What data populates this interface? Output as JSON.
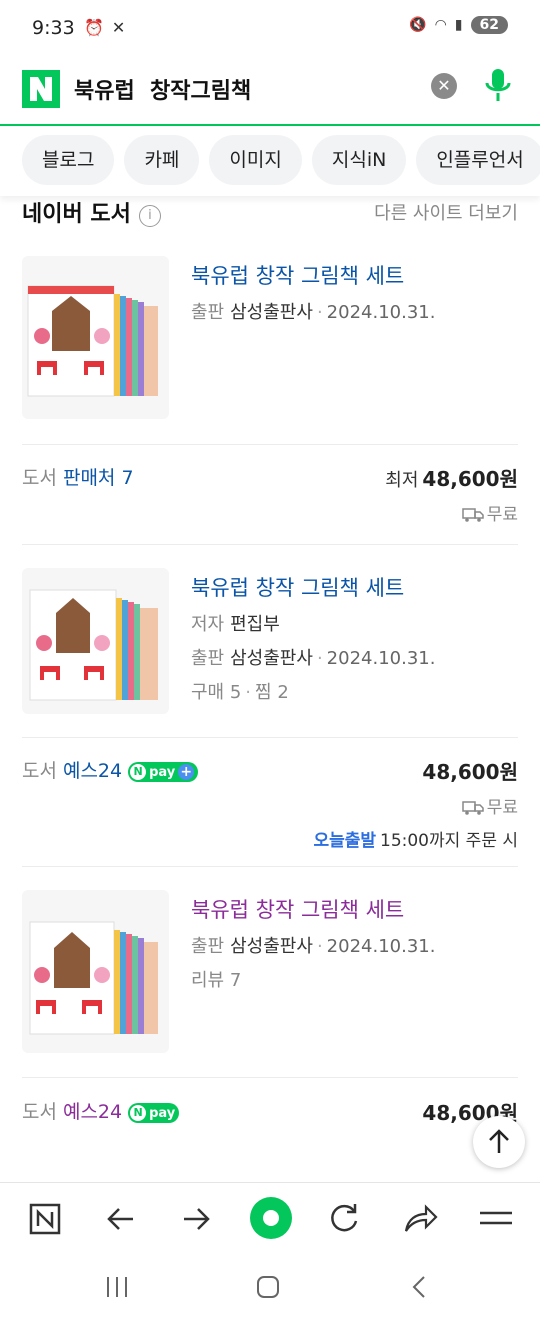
{
  "status_bar": {
    "time": "9:33",
    "battery": "62"
  },
  "search": {
    "query": "북유럽  창작그림책",
    "clear_icon": "close-icon",
    "mic_icon": "mic-icon"
  },
  "tabs": [
    {
      "label": "블로그"
    },
    {
      "label": "카페"
    },
    {
      "label": "이미지"
    },
    {
      "label": "지식iN"
    },
    {
      "label": "인플루언서"
    }
  ],
  "section": {
    "title": "네이버 도서",
    "more_link": "다른 사이트 더보기"
  },
  "items": [
    {
      "title": "북유럽 창작 그림책 세트",
      "publisher_label": "출판",
      "publisher": "삼성출판사",
      "date": "2024.10.31.",
      "seller_category": "도서",
      "seller_name": "판매처 7",
      "price_prefix": "최저",
      "price": "48,600원",
      "shipping": "무료"
    },
    {
      "title": "북유럽 창작 그림책 세트",
      "author_label": "저자",
      "author": "편집부",
      "publisher_label": "출판",
      "publisher": "삼성출판사",
      "date": "2024.10.31.",
      "stats_buy": "구매 5",
      "stats_save": "찜 2",
      "seller_category": "도서",
      "seller_name": "예스24",
      "npay_label": "pay",
      "price": "48,600원",
      "shipping": "무료",
      "delivery_highlight": "오늘출발",
      "delivery_text": "15:00까지 주문 시"
    },
    {
      "title": "북유럽 창작 그림책 세트",
      "publisher_label": "출판",
      "publisher": "삼성출판사",
      "date": "2024.10.31.",
      "review": "리뷰 7",
      "seller_category": "도서",
      "seller_name": "예스24",
      "npay_label": "pay",
      "price": "48,600원"
    }
  ],
  "colors": {
    "naver_green": "#03c75a",
    "link_blue": "#0a55a8",
    "visited_purple": "#8b2c9a",
    "today_blue": "#2b6ee0"
  }
}
